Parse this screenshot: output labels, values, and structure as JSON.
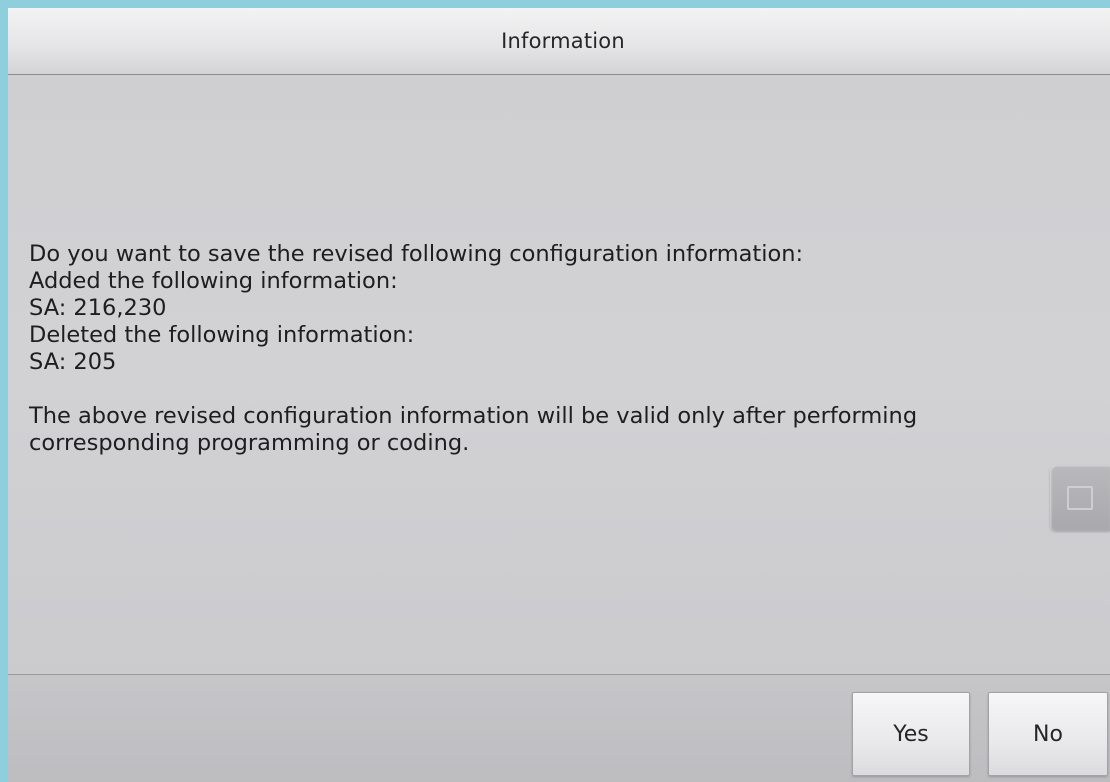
{
  "dialog": {
    "title": "Information",
    "message": {
      "lines": [
        "Do you want to save the revised following configuration information:",
        "Added the following information:",
        "SA: 216,230",
        "Deleted the following information:",
        "SA: 205"
      ],
      "note_lines": [
        "The above revised configuration information will be valid only after performing",
        "corresponding programming or coding."
      ]
    },
    "buttons": {
      "yes_label": "Yes",
      "no_label": "No"
    },
    "side_handle_icon": "panel-handle-icon"
  },
  "colors": {
    "outer_frame": "#8ecedd",
    "dialog_background": "#d0d0d3",
    "title_bar": "#e6e6e8",
    "text": "#1e1e1e"
  }
}
